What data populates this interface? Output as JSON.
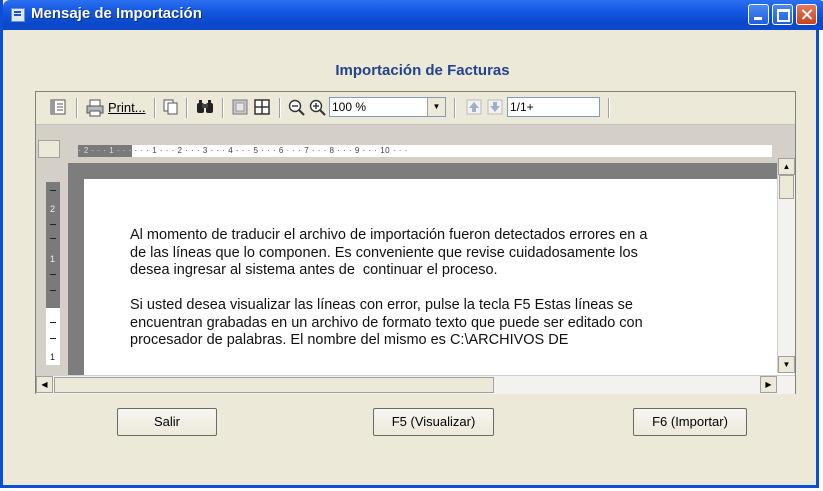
{
  "window": {
    "title": "Mensaje de Importación"
  },
  "heading": "Importación de Facturas",
  "toolbar": {
    "print_label": "Print...",
    "zoom_value": "100 %",
    "page_value": "1/1+"
  },
  "ruler": {
    "shaded_text": "· 2 · · · 1 · · ·",
    "scale_text": "  · · · 1 · · · 2 · · · 3 · · · 4 · · · 5 · · · 6 · · · 7 · · · 8 · · · 9 · · · 10 · · ·",
    "vnum_2": "2",
    "vnum_1a": "1",
    "vnum_1b": "1"
  },
  "document": {
    "lines": [
      "Al momento de traducir el archivo de importación fueron detectados errores en a",
      "de las líneas que lo componen. Es conveniente que revise cuidadosamente los",
      "desea ingresar al sistema antes de  continuar el proceso.",
      "",
      "Si usted desea visualizar las líneas con error, pulse la tecla F5 Estas líneas se",
      "encuentran grabadas en un archivo de formato texto que puede ser editado con",
      "procesador de palabras. El nombre del mismo es C:\\ARCHIVOS DE"
    ]
  },
  "buttons": {
    "exit": "Salir",
    "view": "F5 (Visualizar)",
    "import": "F6 (Importar)"
  },
  "icons": [
    "app-icon",
    "minimize-icon",
    "maximize-icon",
    "close-icon",
    "toggle-tree-icon",
    "print-icon",
    "copy-icon",
    "find-icon",
    "single-page-icon",
    "multi-page-icon",
    "zoom-out-icon",
    "zoom-in-icon",
    "page-up-icon",
    "page-down-icon"
  ]
}
